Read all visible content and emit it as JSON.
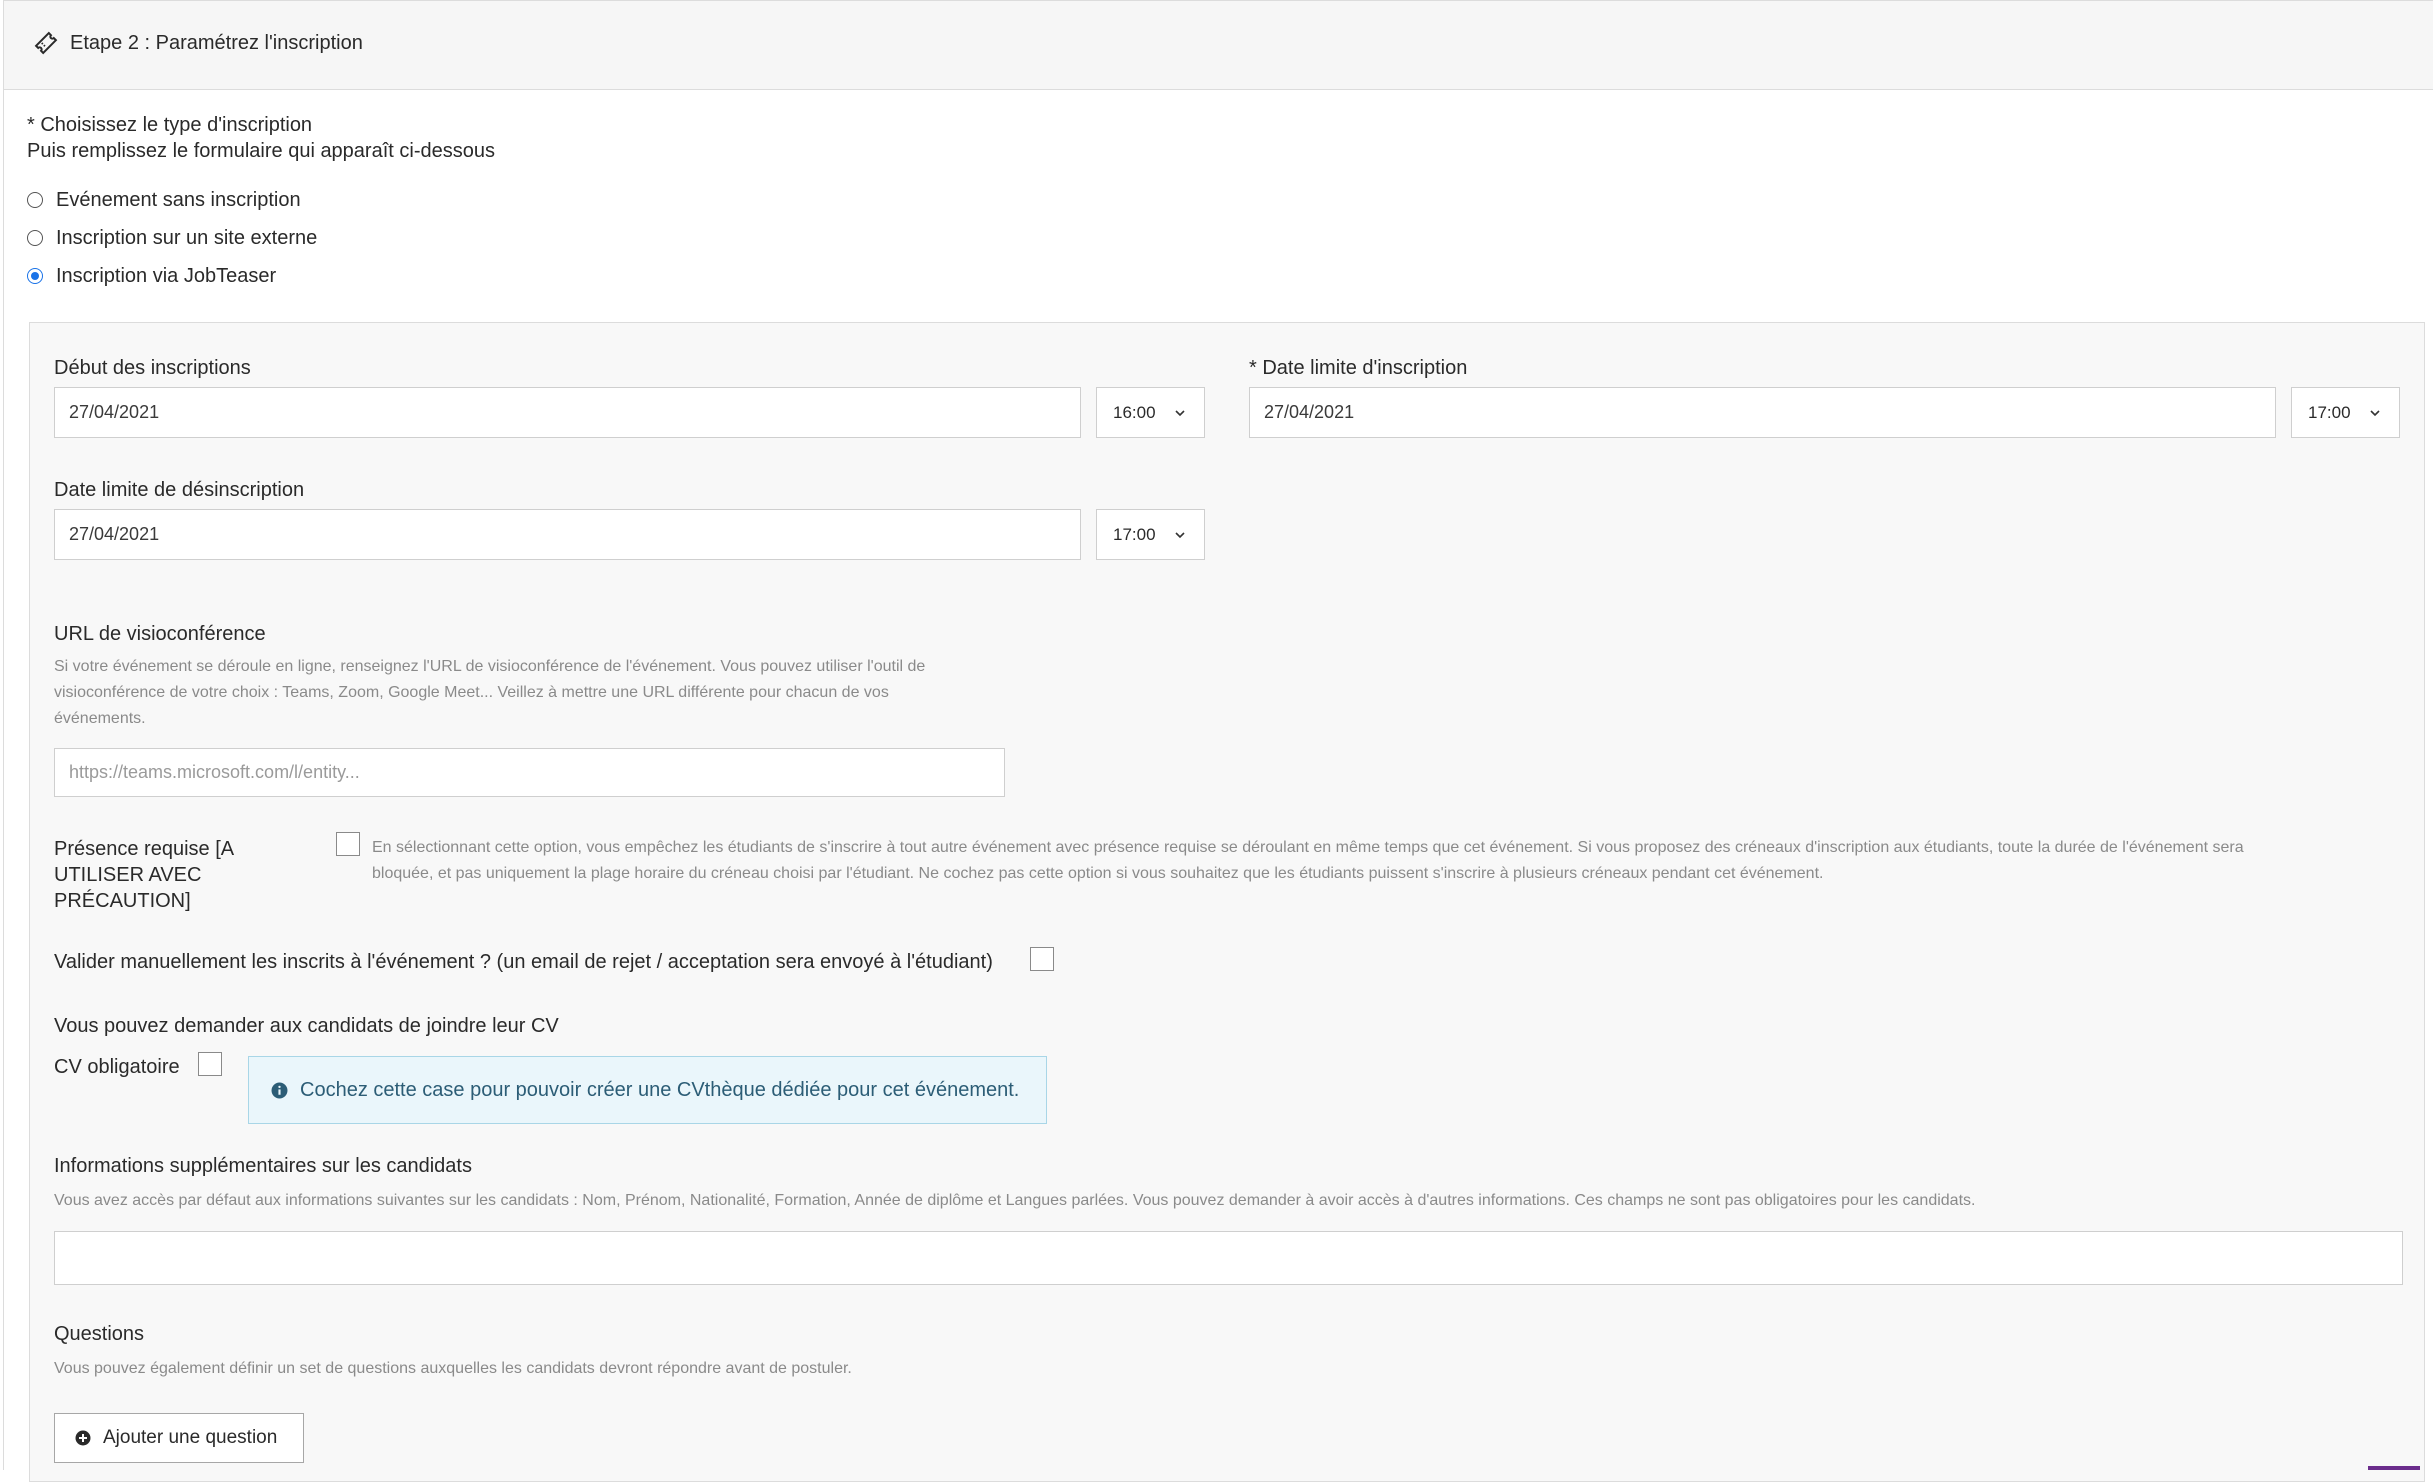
{
  "header": {
    "title": "Etape 2 : Paramétrez l'inscription",
    "icon": "ticket-icon"
  },
  "type_section": {
    "title": "* Choisissez le type d'inscription",
    "subtitle": "Puis remplissez le formulaire qui apparaît ci-dessous",
    "options": [
      {
        "label": "Evénement sans inscription",
        "checked": false
      },
      {
        "label": "Inscription sur un site externe",
        "checked": false
      },
      {
        "label": "Inscription via JobTeaser",
        "checked": true
      }
    ]
  },
  "form": {
    "start": {
      "label": "Début des inscriptions",
      "date": "27/04/2021",
      "time": "16:00"
    },
    "deadline": {
      "label": "* Date limite d'inscription",
      "date": "27/04/2021",
      "time": "17:00"
    },
    "unsubscribe": {
      "label": "Date limite de désinscription",
      "date": "27/04/2021",
      "time": "17:00"
    },
    "video": {
      "label": "URL de visioconférence",
      "hint_lines": [
        "Si votre événement se déroule en ligne, renseignez l'URL de visioconférence de l'événement. Vous pouvez utiliser l'outil de",
        "visioconférence de votre choix : Teams, Zoom, Google Meet... Veillez à mettre une URL différente pour chacun de vos",
        "événements."
      ],
      "placeholder": "https://teams.microsoft.com/l/entity..."
    },
    "presence": {
      "label_lines": [
        "Présence requise [A",
        "UTILISER AVEC",
        "PRÉCAUTION]"
      ],
      "description_lines": [
        "En sélectionnant cette option, vous empêchez les étudiants de s'inscrire à tout autre événement avec présence requise se déroulant en même temps que cet événement. Si vous proposez des créneaux d'inscription aux étudiants, toute la durée de l'événement sera",
        "bloquée, et pas uniquement la plage horaire du créneau choisi par l'étudiant. Ne cochez pas cette option si vous souhaitez que les étudiants puissent s'inscrire à plusieurs créneaux pendant cet événement."
      ],
      "checked": false
    },
    "manual_validation": {
      "label": "Valider manuellement les inscrits à l'événement ? (un email de rejet / acceptation sera envoyé à l'étudiant)",
      "checked": false
    },
    "cv": {
      "intro": "Vous pouvez demander aux candidats de joindre leur CV",
      "label": "CV obligatoire",
      "checked": false,
      "info": "Cochez cette case pour pouvoir créer une CVthèque dédiée pour cet événement."
    },
    "extra_info": {
      "label": "Informations supplémentaires sur les candidats",
      "hint": "Vous avez accès par défaut aux informations suivantes sur les candidats : Nom, Prénom, Nationalité, Formation, Année de diplôme et Langues parlées. Vous pouvez demander à avoir accès à d'autres informations. Ces champs ne sont pas obligatoires pour les candidats.",
      "value": ""
    },
    "questions": {
      "label": "Questions",
      "hint": "Vous pouvez également définir un set de questions auxquelles les candidats devront répondre avant de postuler.",
      "button": "Ajouter une question"
    }
  },
  "colors": {
    "accent": "#1a73e8",
    "info_bg": "#eaf6fb",
    "info_text": "#2c5d76",
    "panel_bg": "#f8f8f8"
  }
}
